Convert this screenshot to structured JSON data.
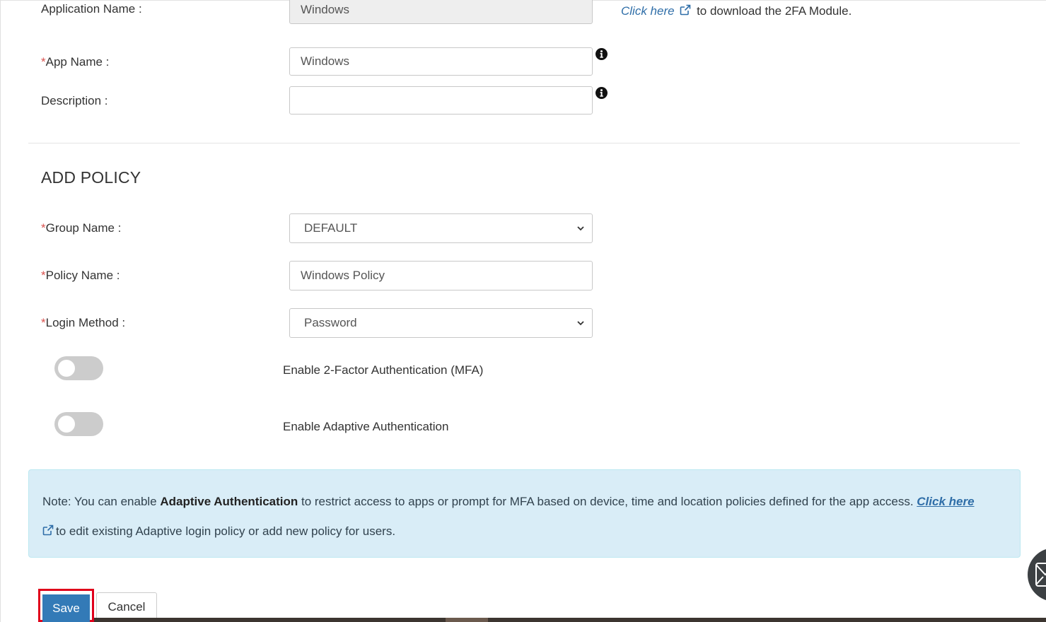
{
  "app_info": {
    "application_name_label": "Application Name :",
    "application_name_value": "Windows",
    "download_link_text": "Click here",
    "download_suffix": "to download the 2FA Module.",
    "app_name_required": "*",
    "app_name_label": "App Name :",
    "app_name_value": "Windows",
    "description_label": "Description :",
    "description_value": ""
  },
  "policy": {
    "section_title": "ADD POLICY",
    "group_name_required": "*",
    "group_name_label": "Group Name :",
    "group_name_value": "DEFAULT",
    "policy_name_required": "*",
    "policy_name_label": "Policy Name :",
    "policy_name_value": "Windows Policy",
    "login_method_required": "*",
    "login_method_label": "Login Method :",
    "login_method_value": "Password"
  },
  "toggles": {
    "mfa_label": "Enable 2-Factor Authentication (MFA)",
    "mfa_enabled": false,
    "adaptive_label": "Enable Adaptive Authentication",
    "adaptive_enabled": false
  },
  "note": {
    "prefix": "Note: You can enable ",
    "bold": "Adaptive Authentication",
    "middle": " to restrict access to apps or prompt for MFA based on device, time and location policies defined for the app access. ",
    "link_text": "Click here",
    "suffix": "to edit existing Adaptive login policy or add new policy for users."
  },
  "actions": {
    "save_label": "Save",
    "cancel_label": "Cancel"
  },
  "colors": {
    "primary": "#337ab7",
    "link": "#2f6ea8",
    "required": "#d9534f",
    "note_bg": "#d9edf7",
    "highlight": "#e0001b"
  },
  "icons": {
    "info": "info-circle-icon",
    "external": "external-link-icon",
    "chevron": "chevron-down-icon",
    "chat": "chat-widget-icon"
  }
}
